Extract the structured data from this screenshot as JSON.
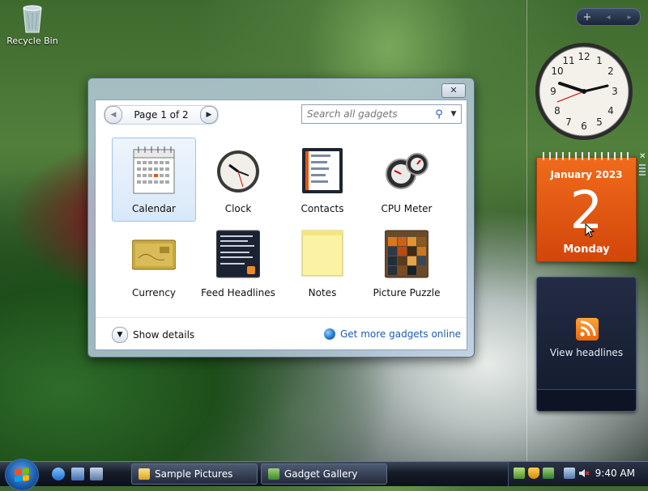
{
  "desktop": {
    "recycle_bin_label": "Recycle Bin"
  },
  "sidebar": {
    "controls": {
      "add": "+",
      "prev": "◂",
      "next": "▸"
    },
    "calendar": {
      "month_year": "January 2023",
      "day": "2",
      "weekday": "Monday"
    },
    "feed": {
      "label": "View headlines"
    }
  },
  "gallery": {
    "pager": {
      "text": "Page 1 of 2"
    },
    "search": {
      "placeholder": "Search all gadgets"
    },
    "gadgets": [
      {
        "name": "Calendar",
        "selected": true,
        "icon": "calendar-gadget-icon"
      },
      {
        "name": "Clock",
        "selected": false,
        "icon": "clock-gadget-icon"
      },
      {
        "name": "Contacts",
        "selected": false,
        "icon": "contacts-gadget-icon"
      },
      {
        "name": "CPU Meter",
        "selected": false,
        "icon": "cpu-meter-gadget-icon"
      },
      {
        "name": "Currency",
        "selected": false,
        "icon": "currency-gadget-icon"
      },
      {
        "name": "Feed Headlines",
        "selected": false,
        "icon": "feed-headlines-gadget-icon"
      },
      {
        "name": "Notes",
        "selected": false,
        "icon": "notes-gadget-icon"
      },
      {
        "name": "Picture Puzzle",
        "selected": false,
        "icon": "picture-puzzle-gadget-icon"
      }
    ],
    "show_details": "Show details",
    "get_more": "Get more gadgets online"
  },
  "taskbar": {
    "buttons": [
      {
        "label": "Sample Pictures",
        "icon": "folder-icon"
      },
      {
        "label": "Gadget Gallery",
        "icon": "gadget-gallery-icon"
      }
    ],
    "time": "9:40 AM"
  },
  "colors": {
    "calendar_orange": "#e8550f",
    "link_blue": "#1a5cb5",
    "selection_blue": "#d8e8f9"
  }
}
